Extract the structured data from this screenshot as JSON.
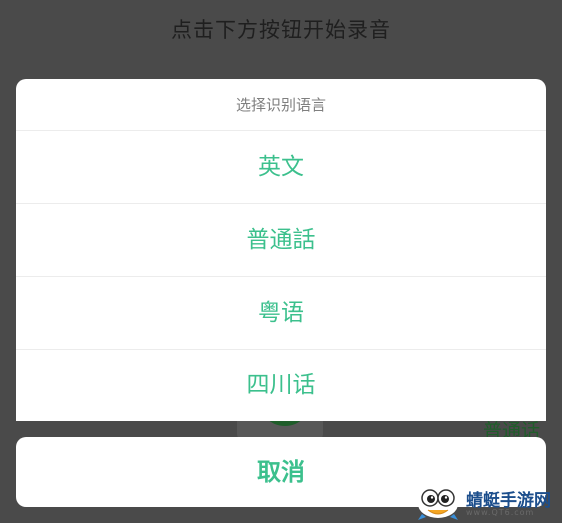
{
  "background": {
    "title": "点击下方按钮开始录音",
    "current_language": "普通话"
  },
  "sheet": {
    "title": "选择识别语言",
    "options": [
      {
        "label": "英文"
      },
      {
        "label": "普通話"
      },
      {
        "label": "粤语"
      },
      {
        "label": "四川话"
      }
    ],
    "cancel_label": "取消"
  },
  "watermark": {
    "name": "蜻蜓手游网",
    "url": "www.QT6.com"
  },
  "colors": {
    "accent": "#3cc08d",
    "overlay": "#4a4a4a",
    "sheet_bg": "#ffffff",
    "title_gray": "#7f7f7f"
  }
}
